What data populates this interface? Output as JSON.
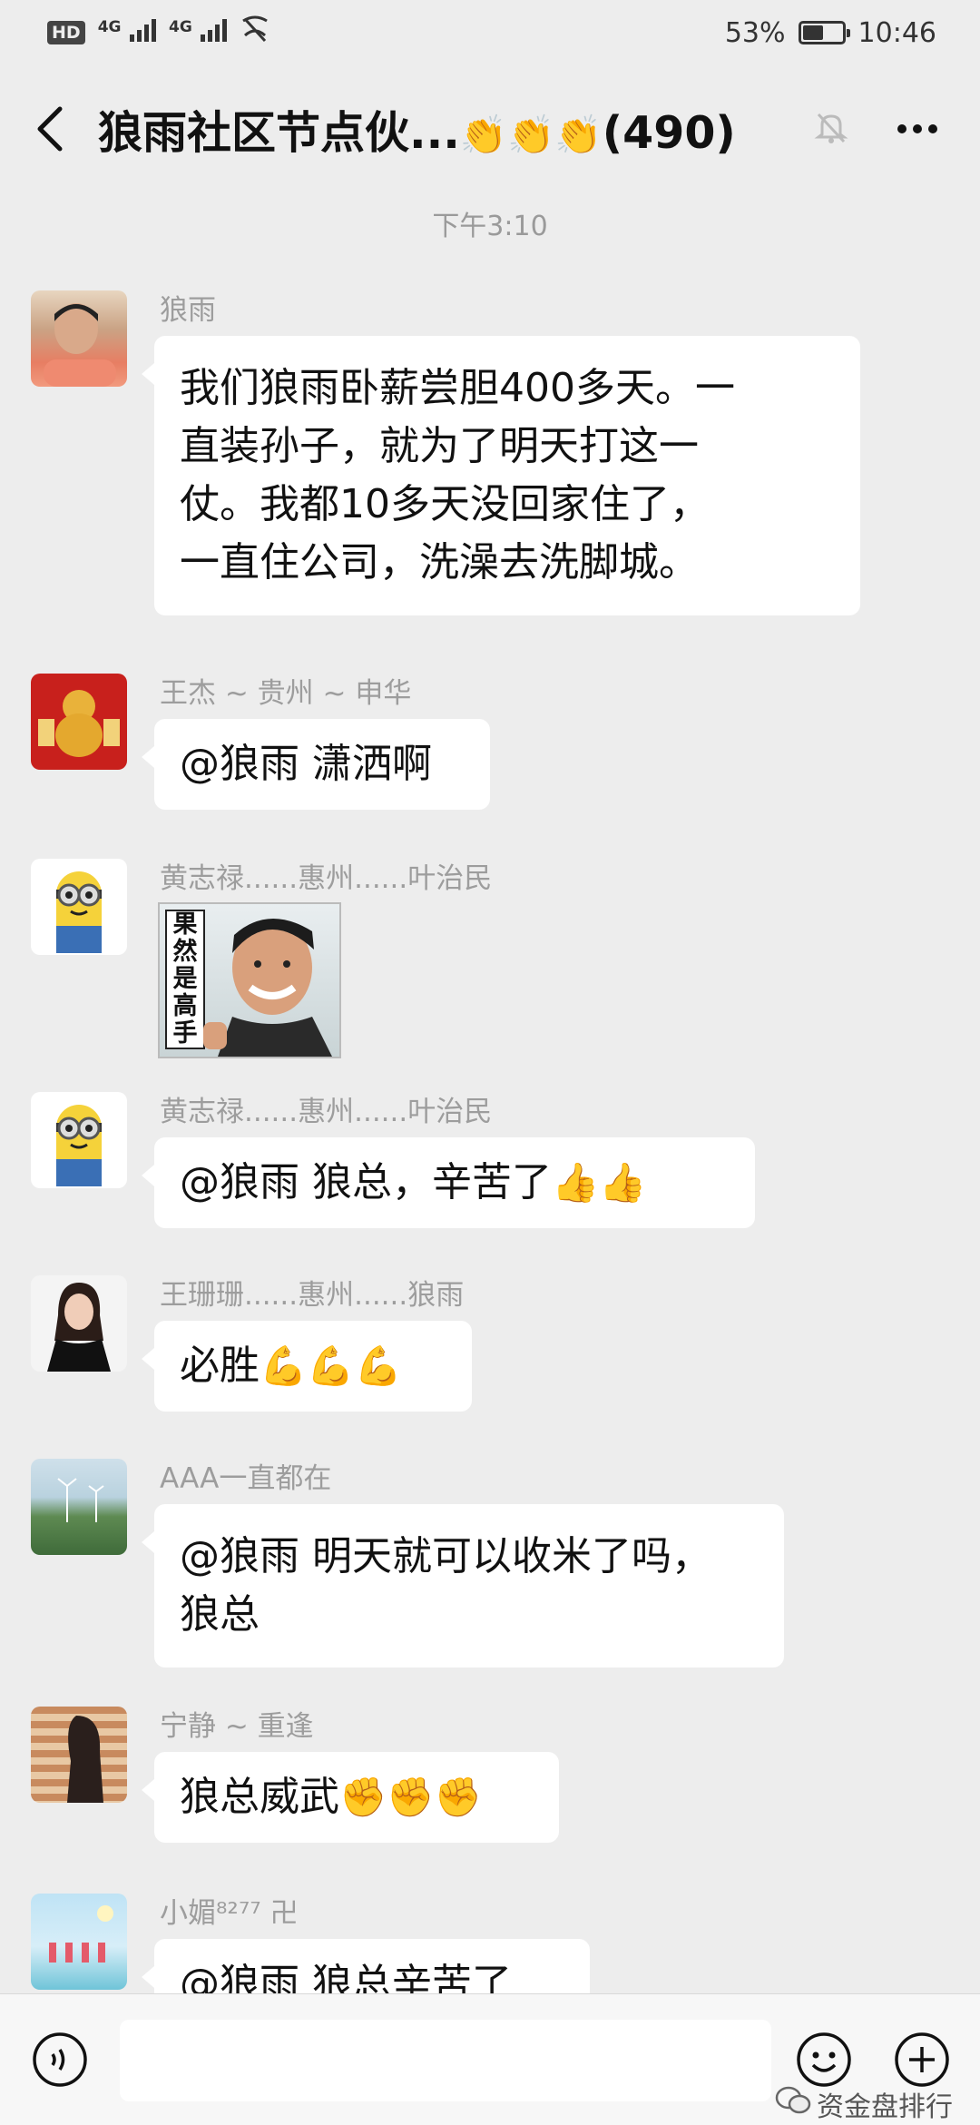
{
  "status_bar": {
    "hd": "HD",
    "network1": "4G",
    "network2": "4G",
    "battery_pct": "53%",
    "battery_level": 0.53,
    "time": "10:46"
  },
  "header": {
    "title": "狼雨社区节点伙...",
    "title_emojis": "👏👏👏",
    "member_count": "(490)",
    "icons": [
      "back-icon",
      "mute-bell-icon",
      "more-icon"
    ]
  },
  "timestamp": "下午3:10",
  "messages": [
    {
      "sender": "狼雨",
      "lines": [
        "我们狼雨卧薪尝胆400多天。一",
        "直装孙子，就为了明天打这一",
        "仗。我都10多天没回家住了，",
        "一直住公司，洗澡去洗脚城。"
      ]
    },
    {
      "sender": "王杰 ~ 贵州 ~ 申华",
      "text": "@狼雨  潇洒啊"
    },
    {
      "sender": "黄志禄......惠州......叶治民",
      "sticker_text": "果然是高手"
    },
    {
      "sender": "黄志禄......惠州......叶治民",
      "text": "@狼雨  狼总，辛苦了",
      "emojis": "👍👍"
    },
    {
      "sender": "王珊珊......惠州......狼雨",
      "text": "必胜",
      "emojis": "💪💪💪"
    },
    {
      "sender": "AAA一直都在",
      "lines": [
        "@狼雨  明天就可以收米了吗，",
        "狼总"
      ]
    },
    {
      "sender": "宁静 ~ 重逢",
      "text": "狼总威武",
      "emojis": "✊✊✊"
    },
    {
      "sender": "小媚⁸²⁷⁷ 卍",
      "text": "@狼雨  狼总辛苦了"
    }
  ],
  "input_bar": {
    "icons": [
      "voice-icon",
      "emoji-icon",
      "plus-icon"
    ]
  },
  "watermark": "资金盘排行"
}
